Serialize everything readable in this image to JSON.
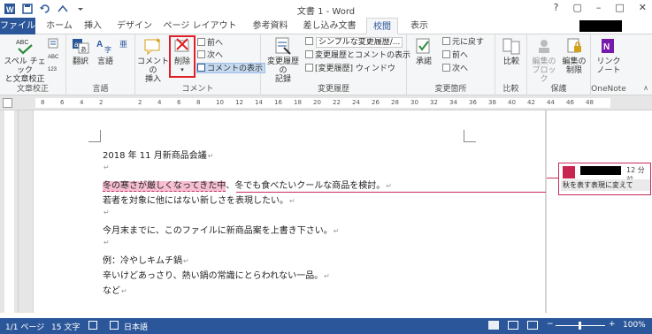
{
  "window": {
    "title": "文書 1 - Word",
    "controls": [
      "?",
      "▢",
      "–",
      "□",
      "✕"
    ]
  },
  "tabs": [
    "ファイル",
    "ホーム",
    "挿入",
    "デザイン",
    "ページ レイアウト",
    "参考資料",
    "差し込み文書",
    "校閲",
    "表示"
  ],
  "ribbon": {
    "proofing": {
      "spell_label": "スペル チェック\nと文章校正",
      "group": "文章校正"
    },
    "language": {
      "translate": "翻訳",
      "language": "言語",
      "group": "言語"
    },
    "comments": {
      "new": "コメントの\n挿入",
      "delete": "削除",
      "prev": "前へ",
      "next": "次へ",
      "show": "コメントの表示",
      "group": "コメント"
    },
    "tracking": {
      "track": "変更履歴の\n記録",
      "display": "シンプルな変更履歴/...",
      "show_markup": "変更履歴とコメントの表示",
      "pane": "[変更履歴] ウィンドウ",
      "group": "変更履歴"
    },
    "changes": {
      "accept": "承諾",
      "prev": "元に戻す",
      "previous": "前へ",
      "next": "次へ",
      "group": "変更箇所"
    },
    "compare": {
      "label": "比較",
      "group": "比較"
    },
    "protect": {
      "block": "編集の\nブロック",
      "restrict": "編集の\n制限",
      "group": "保護"
    },
    "onenote": {
      "label": "リンク\nノート",
      "group": "OneNote"
    }
  },
  "ruler": {
    "numbers": [
      "8",
      "6",
      "4",
      "2",
      "",
      "2",
      "4",
      "6",
      "8",
      "10",
      "12",
      "14",
      "16",
      "18",
      "20",
      "22",
      "24",
      "26",
      "28",
      "30",
      "32",
      "34",
      "36",
      "38",
      "40",
      "42",
      "44",
      "46",
      "48"
    ]
  },
  "document": {
    "lines": [
      "2018 年 11 月新商品会議",
      "",
      "冬の寒さが厳しくなってきた中、冬でも食べたいクールな商品を検討。",
      "若者を対象に他にはない新しさを表現したい。",
      "",
      "今月末までに、このファイルに新商品案を上書き下さい。",
      "",
      "例：冷やしキムチ鍋",
      "辛いけどあっさり、熱い鍋の常識にとらわれない一品。",
      "など"
    ],
    "highlight_text": "冬の寒さが厳しくなってきた中",
    "highlight_rest": "、冬でも食べたいクールな商品を検討。",
    "para_mark": "↵"
  },
  "comment": {
    "time": "12 分前",
    "text": "秋を表す表現に変えて"
  },
  "status": {
    "page": "1/1 ページ",
    "words": "15 文字",
    "lang": "日本語",
    "zoom": "100%"
  },
  "colors": {
    "accent": "#2b579a",
    "comment": "#c82d5a",
    "highlight": "#f7bfd1",
    "focus_box": "#e01f26"
  }
}
